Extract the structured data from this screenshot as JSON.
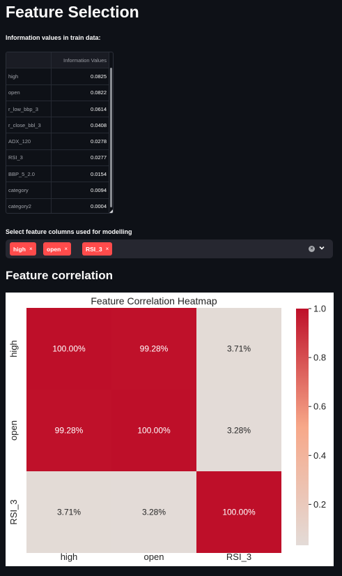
{
  "page": {
    "title": "Feature Selection",
    "info_label": "Information values in train data:",
    "select_label": "Select feature columns used for modelling",
    "correlation_header": "Feature correlation"
  },
  "dataframe": {
    "column_header": "Information Values",
    "rows": [
      {
        "name": "high",
        "value": "0.0825"
      },
      {
        "name": "open",
        "value": "0.0822"
      },
      {
        "name": "r_low_bbp_3",
        "value": "0.0614"
      },
      {
        "name": "r_close_bbl_3",
        "value": "0.0408"
      },
      {
        "name": "ADX_120",
        "value": "0.0278"
      },
      {
        "name": "RSI_3",
        "value": "0.0277"
      },
      {
        "name": "BBP_5_2.0",
        "value": "0.0154"
      },
      {
        "name": "category",
        "value": "0.0094"
      },
      {
        "name": "category2",
        "value": "0.0004"
      }
    ]
  },
  "multiselect": {
    "selected": [
      "high",
      "open",
      "RSI_3"
    ],
    "remove_glyph": "×",
    "clear_icon": "clear-icon",
    "dropdown_icon": "chevron-down-icon",
    "chip_color": "#ff4b4b"
  },
  "chart_data": {
    "type": "heatmap",
    "title": "Feature Correlation Heatmap",
    "x_categories": [
      "high",
      "open",
      "RSI_3"
    ],
    "y_categories": [
      "high",
      "open",
      "RSI_3"
    ],
    "values": [
      [
        1.0,
        0.9928,
        0.0371
      ],
      [
        0.9928,
        1.0,
        0.0328
      ],
      [
        0.0371,
        0.0328,
        1.0
      ]
    ],
    "annotations": [
      [
        "100.00%",
        "99.28%",
        "3.71%"
      ],
      [
        "99.28%",
        "100.00%",
        "3.28%"
      ],
      [
        "3.71%",
        "3.28%",
        "100.00%"
      ]
    ],
    "colorbar": {
      "ticks": [
        0.2,
        0.4,
        0.6,
        0.8,
        1.0
      ],
      "tick_labels": [
        "0.2",
        "0.4",
        "0.6",
        "0.8",
        "1.0"
      ],
      "range": [
        0.0328,
        1.0
      ],
      "colormap": "coolwarm-reds",
      "low_color": "#e3dbd7",
      "mid_color": "#f7a889",
      "high_color": "#be0f29"
    },
    "grid": false,
    "legend": "colorbar-right"
  }
}
